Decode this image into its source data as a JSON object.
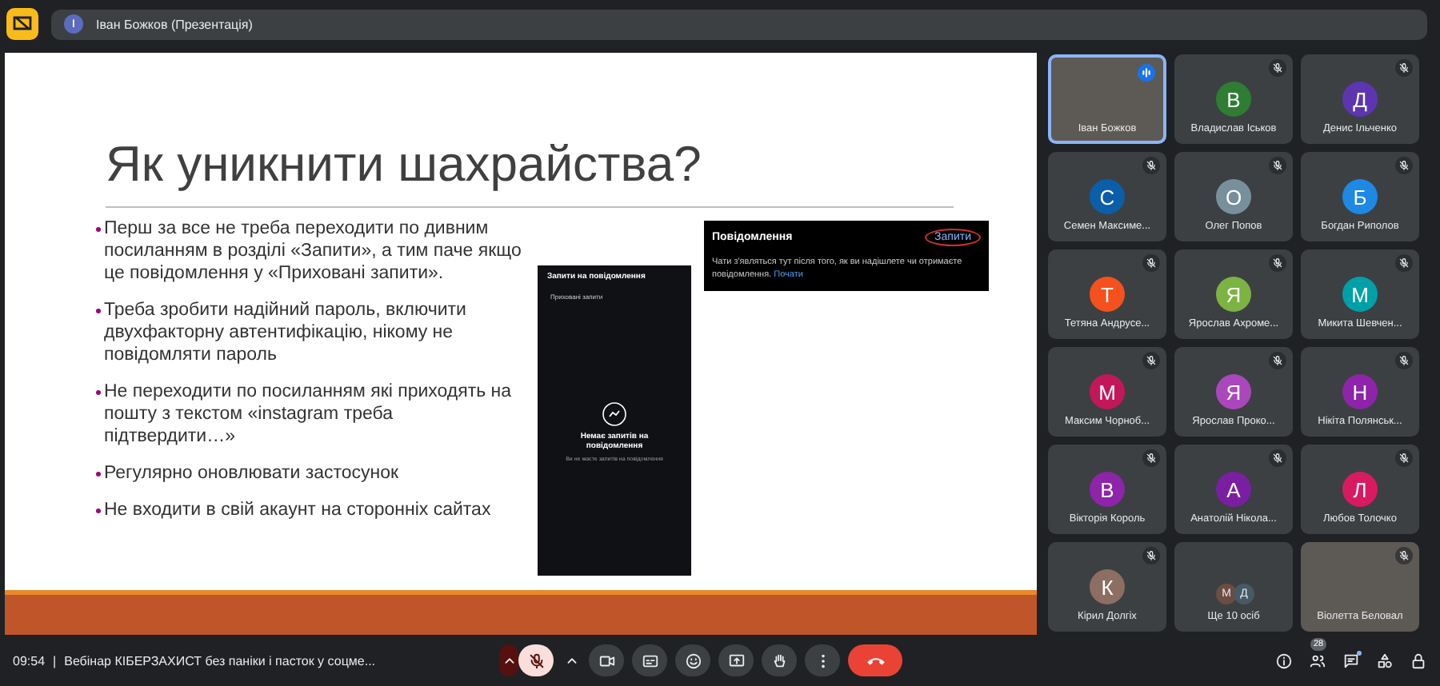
{
  "top_bar": {
    "presenter_initial": "I",
    "presenter_label": "Іван Божков (Презентація)"
  },
  "slide": {
    "title": "Як уникнити шахрайства?",
    "bullets": [
      "Перш за все не треба переходити по дивним посиланням в розділі «Запити», а тим паче якщо це повідомлення у «Приховані запити».",
      "Треба зробити надійний пароль, включити двухфакторну автентифікацію, нікому не повідомляти пароль",
      "Не переходити по посиланням які приходять на пошту з текстом «instagram треба підтвердити…»",
      "Регулярно оновлювати застосунок",
      "Не входити в свій акаунт на сторонніх сайтах"
    ],
    "phone": {
      "header": "Запити на повідомлення",
      "row": "Приховані запити",
      "empty_title": "Немає запитів на повідомлення",
      "empty_text": "Ви не маєте запитів на повідомлення"
    },
    "notice": {
      "title": "Повідомлення",
      "requests": "Запити",
      "text": "Чати з'являться тут після того, як ви надішлете чи отримаєте повідомлення.",
      "link": "Почати"
    }
  },
  "participants": [
    {
      "kind": "video",
      "name": "Іван Божков",
      "muted": false,
      "speaking": true
    },
    {
      "kind": "avatar",
      "name": "Владислав Іськов",
      "initial": "В",
      "color": "#2e7d32",
      "muted": true
    },
    {
      "kind": "avatar",
      "name": "Денис Ільченко",
      "initial": "Д",
      "color": "#5e35b1",
      "muted": true
    },
    {
      "kind": "avatar",
      "name": "Семен Максиме...",
      "initial": "С",
      "color": "#0b5ea8",
      "muted": true
    },
    {
      "kind": "avatar",
      "name": "Олег Попов",
      "initial": "О",
      "color": "#78909c",
      "muted": true
    },
    {
      "kind": "avatar",
      "name": "Богдан Риполов",
      "initial": "Б",
      "color": "#1e88e5",
      "muted": true
    },
    {
      "kind": "avatar",
      "name": "Тетяна Андрусе...",
      "initial": "Т",
      "color": "#f4511e",
      "muted": true
    },
    {
      "kind": "avatar",
      "name": "Ярослав Ахроме...",
      "initial": "Я",
      "color": "#7cb342",
      "muted": true
    },
    {
      "kind": "avatar",
      "name": "Микита Шевчен...",
      "initial": "М",
      "color": "#00a0a8",
      "muted": true
    },
    {
      "kind": "avatar",
      "name": "Максим Чорноб...",
      "initial": "М",
      "color": "#c2185b",
      "muted": true
    },
    {
      "kind": "avatar",
      "name": "Ярослав Проко...",
      "initial": "Я",
      "color": "#ab47bc",
      "muted": true
    },
    {
      "kind": "avatar",
      "name": "Нікіта Полянськ...",
      "initial": "Н",
      "color": "#8e24aa",
      "muted": true
    },
    {
      "kind": "avatar",
      "name": "Вікторія Король",
      "initial": "В",
      "color": "#8e24aa",
      "muted": true
    },
    {
      "kind": "avatar",
      "name": "Анатолій Нікола...",
      "initial": "А",
      "color": "#7b1fa2",
      "muted": true
    },
    {
      "kind": "avatar",
      "name": "Любов Толочко",
      "initial": "Л",
      "color": "#d81b60",
      "muted": true
    },
    {
      "kind": "avatar",
      "name": "Кірил Долгіх",
      "initial": "К",
      "color": "#8d6e63",
      "muted": true
    },
    {
      "kind": "more",
      "name": "Ще 10 осіб",
      "avatars": [
        {
          "initial": "М",
          "color": "#6d4c41"
        },
        {
          "initial": "Д",
          "color": "#455a64"
        }
      ]
    },
    {
      "kind": "video",
      "name": "Віолетта Беловал",
      "muted": true,
      "speaking": false
    }
  ],
  "bottom_bar": {
    "time": "09:54",
    "separator": "|",
    "meeting_title": "Вебінар КІБЕРЗАХИСТ без паніки і пасток у соцме...",
    "mic_muted": true,
    "people_count": "28",
    "chat_unread": true
  }
}
